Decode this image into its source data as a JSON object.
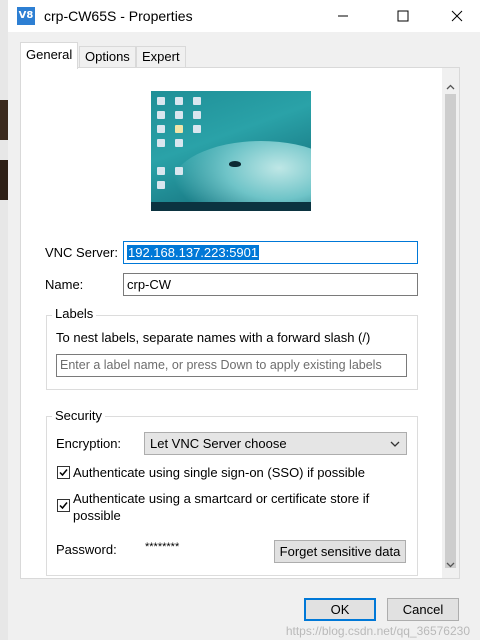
{
  "window": {
    "app_icon": "V8",
    "title": "crp-CW65S - Properties",
    "minimize_icon": "minimize-icon",
    "maximize_icon": "maximize-icon",
    "close_icon": "close-icon"
  },
  "tabs": [
    {
      "label": "General",
      "active": true
    },
    {
      "label": "Options",
      "active": false
    },
    {
      "label": "Expert",
      "active": false
    }
  ],
  "general": {
    "vnc_server_label": "VNC Server:",
    "vnc_server_value": "192.168.137.223:5901",
    "name_label": "Name:",
    "name_value": "crp-CW",
    "labels_group_title": "Labels",
    "labels_hint": "To nest labels, separate names with a forward slash (/)",
    "labels_placeholder": "Enter a label name, or press Down to apply existing labels",
    "security_group_title": "Security",
    "encryption_label": "Encryption:",
    "encryption_value": "Let VNC Server choose",
    "sso_label": "Authenticate using single sign-on (SSO) if possible",
    "sso_checked": true,
    "smartcard_label": "Authenticate using a smartcard or certificate store if possible",
    "smartcard_checked": true,
    "password_label": "Password:",
    "password_value": "********",
    "forget_button": "Forget sensitive data"
  },
  "footer": {
    "ok_button": "OK",
    "cancel_button": "Cancel"
  },
  "watermark": "https://blog.csdn.net/qq_36576230",
  "colors": {
    "accent": "#0078d7",
    "selection_bg": "#0078d7"
  }
}
